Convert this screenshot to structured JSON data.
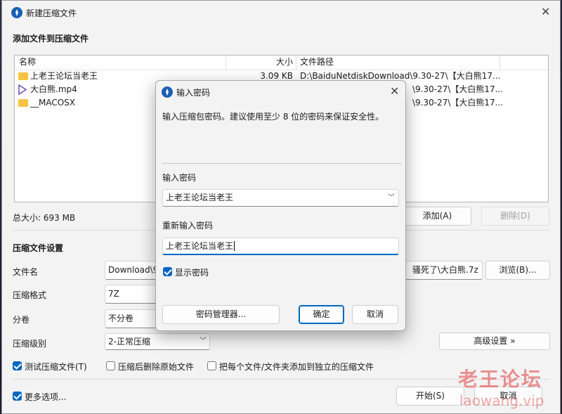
{
  "window": {
    "title": "新建压缩文件"
  },
  "files": {
    "section_title": "添加文件到压缩文件",
    "columns": {
      "name": "名称",
      "size": "大小",
      "path": "文件路径"
    },
    "rows": [
      {
        "icon": "folder-icon",
        "name": "上老王论坛当老王",
        "size": "3.09 KB",
        "path": "D:\\BaiduNetdiskDownload\\9.30-27\\【大白熊17..."
      },
      {
        "icon": "video-file-icon",
        "name": "大白熊.mp4",
        "size": "",
        "path": "\\9.30-27\\【大白熊17..."
      },
      {
        "icon": "folder-icon",
        "name": "__MACOSX",
        "size": "",
        "path": "\\9.30-27\\【大白熊17..."
      }
    ],
    "total": "总大小: 693 MB",
    "add_label": "添加(A)",
    "remove_label": "删除(D)"
  },
  "settings": {
    "section_title": "压缩文件设置",
    "filename_label": "文件名",
    "filename_value": "Download\\9",
    "filename_tail": "骚死了\\大白熊.7z",
    "browse_label": "浏览(B)...",
    "format_label": "压缩格式",
    "format_value": "7Z",
    "split_label": "分卷",
    "split_value": "不分卷",
    "level_label": "压缩级别",
    "level_value": "2-正常压缩",
    "advanced_label": "高级设置 »",
    "test_label": "测试压缩文件(T)",
    "delete_after_label": "压缩后删除原始文件",
    "each_separate_label": "把每个文件/文件夹添加到独立的压缩文件",
    "more_options_label": "更多选项...",
    "start_label": "开始(S)",
    "cancel_label": "取消"
  },
  "dialog": {
    "title": "输入密码",
    "description": "输入压缩包密码。建议使用至少 8 位的密码来保证安全性。",
    "password_label": "输入密码",
    "password_value": "上老王论坛当老王",
    "reenter_label": "重新输入密码",
    "reenter_value": "上老王论坛当老王",
    "show_password_label": "显示密码",
    "manager_label": "密码管理器...",
    "ok_label": "确定",
    "cancel_label": "取消"
  },
  "watermark": {
    "line1": "老王论坛",
    "line2": "laowang.vip"
  }
}
